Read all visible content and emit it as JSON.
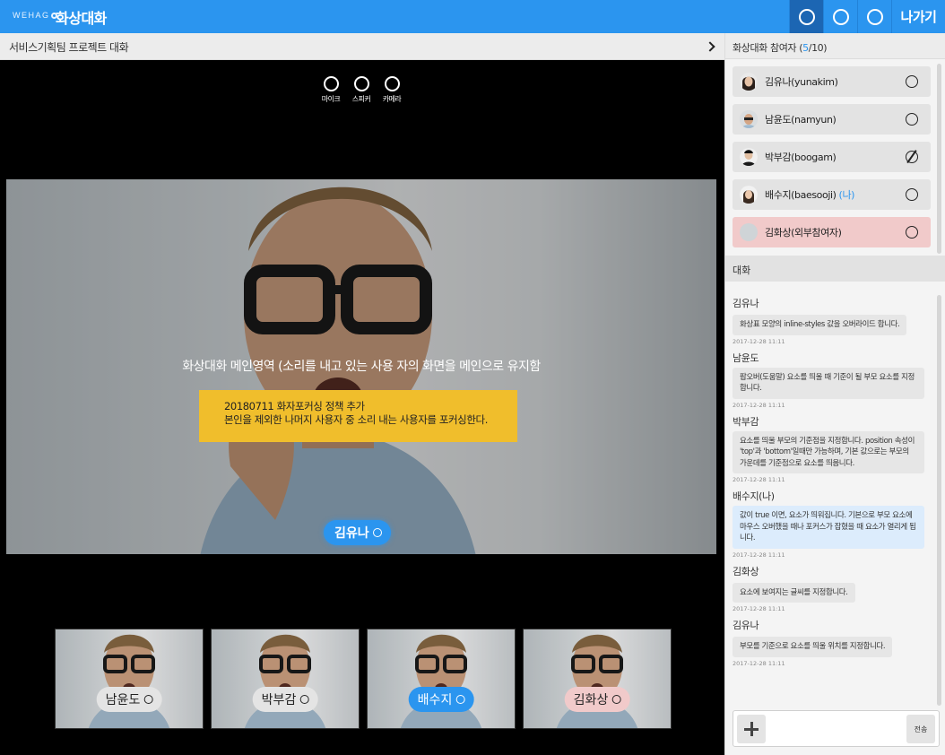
{
  "topbar": {
    "brand": "WEHAG",
    "app_title": "화상대화",
    "exit_label": "나가기"
  },
  "room": {
    "title": "서비스기획팀 프로젝트 대화"
  },
  "controls": [
    {
      "label": "마이크",
      "icon": "mic-icon"
    },
    {
      "label": "스피커",
      "icon": "speaker-icon"
    },
    {
      "label": "카메라",
      "icon": "camera-icon"
    }
  ],
  "main_video": {
    "caption": "화상대화 메인영역 (소리를 내고 있는 사용 자의 화면을 메인으로 유지함",
    "note_line1": "20180711 화자포커싱 정책 추가",
    "note_line2": "본인을 제외한 나머지 사용자 중 소리 내는 사용자를 포커싱한다.",
    "speaker": "김유나"
  },
  "thumbnails": [
    {
      "name": "남윤도",
      "style": "gray"
    },
    {
      "name": "박부감",
      "style": "gray"
    },
    {
      "name": "배수지",
      "style": "blue"
    },
    {
      "name": "김화상",
      "style": "pink"
    }
  ],
  "participants": {
    "heading": "화상대화 참여자",
    "count_current": "5",
    "count_sep": "/",
    "count_max": "10",
    "open_paren": "(",
    "close_paren": ")",
    "items": [
      {
        "name": "김유나(yunakim)",
        "me": "",
        "status": "on"
      },
      {
        "name": "남윤도(namyun)",
        "me": "",
        "status": "on"
      },
      {
        "name": "박부감(boogam)",
        "me": "",
        "status": "muted"
      },
      {
        "name": "배수지(baesooji)",
        "me": "(나)",
        "status": "on"
      },
      {
        "name": "김화상(외부참여자)",
        "me": "",
        "status": "on",
        "external": true
      }
    ]
  },
  "chat": {
    "heading": "대화",
    "messages": [
      {
        "sender": "김유나",
        "text": "화상표 모양의 inline-styles 값을 오버라이드 합니다.",
        "time": "2017-12-28 11:11",
        "mine": false
      },
      {
        "sender": "남윤도",
        "text": "팝오버(도움말) 요소를 띄울 때 기준이 될 부모 요소를 지정합니다.",
        "time": "2017-12-28 11:11",
        "mine": false
      },
      {
        "sender": "박부감",
        "text": "요소를 띄울 부모의 기준점을 지정합니다. position 속성이 'top'과 'bottom'일때만 가능하며, 기본 값으로는 부모의 가운데를 기준점으로 요소를 띄웁니다.",
        "time": "2017-12-28 11:11",
        "mine": false
      },
      {
        "sender": "배수지(나)",
        "text": "값이 true 이면, 요소가 띄워집니다. 기본으로 부모 요소에 마우스 오버했을 때나 포커스가 잡혔을 때 요소가 열리게 됩니다.",
        "time": "2017-12-28 11:11",
        "mine": true
      },
      {
        "sender": "김화상",
        "text": "요소에 보여지는 글씨를 지정합니다.",
        "time": "2017-12-28 11:11",
        "mine": false
      },
      {
        "sender": "김유나",
        "text": "부모를 기준으로 요소를 띄울 위치를 지정합니다.",
        "time": "2017-12-28 11:11",
        "mine": false
      }
    ],
    "input_placeholder": "",
    "send_label": "전송"
  },
  "colors": {
    "accent": "#2b95ef",
    "note": "#f0be2c",
    "external": "#f1caca"
  }
}
